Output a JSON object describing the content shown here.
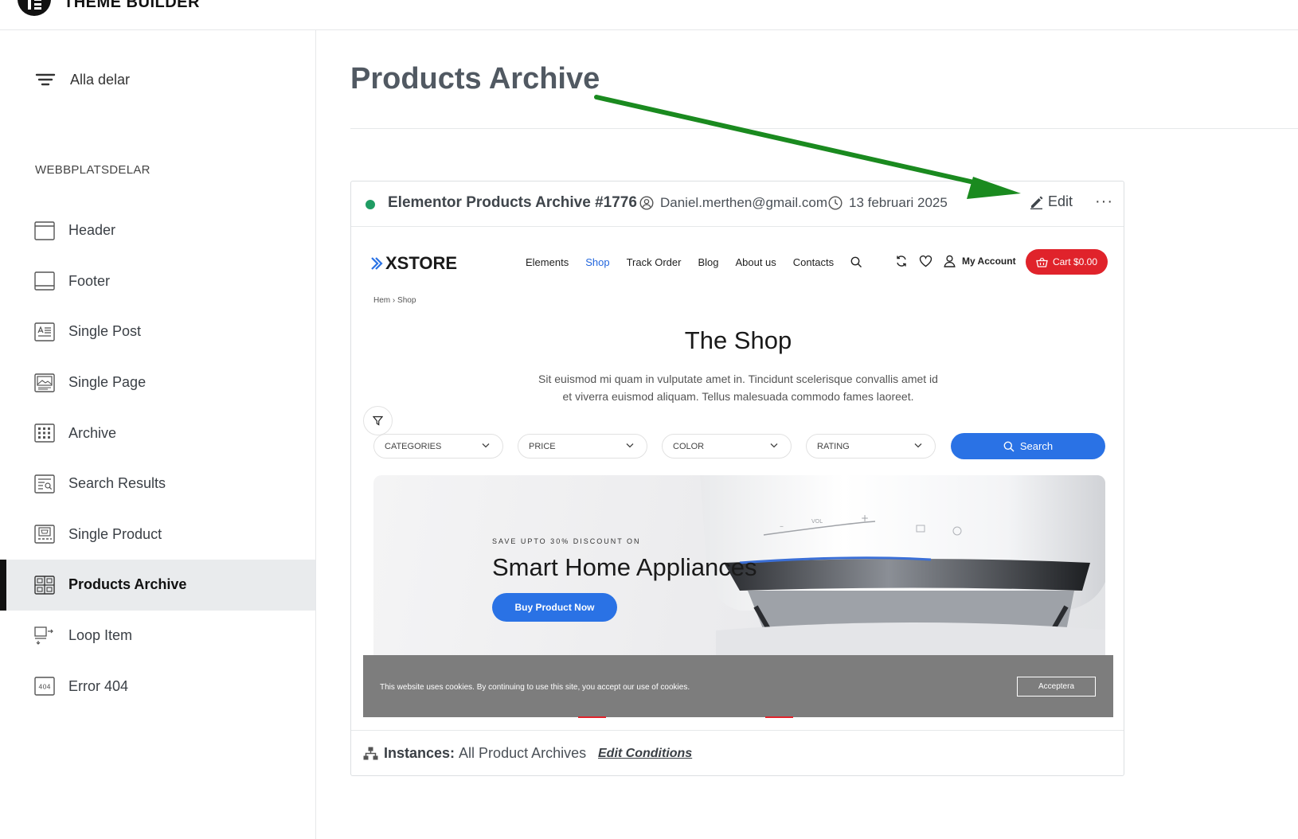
{
  "app": {
    "title": "THEME BUILDER"
  },
  "sidebar": {
    "all_parts": "Alla delar",
    "section_label": "WEBBPLATSDELAR",
    "items": [
      {
        "label": "Header",
        "icon": "header-icon"
      },
      {
        "label": "Footer",
        "icon": "footer-icon"
      },
      {
        "label": "Single Post",
        "icon": "single-post-icon"
      },
      {
        "label": "Single Page",
        "icon": "single-page-icon"
      },
      {
        "label": "Archive",
        "icon": "archive-icon"
      },
      {
        "label": "Search Results",
        "icon": "search-results-icon"
      },
      {
        "label": "Single Product",
        "icon": "single-product-icon"
      },
      {
        "label": "Products Archive",
        "icon": "products-archive-icon",
        "active": true
      },
      {
        "label": "Loop Item",
        "icon": "loop-item-icon"
      },
      {
        "label": "Error 404",
        "icon": "error-404-icon"
      }
    ]
  },
  "main": {
    "title": "Products Archive"
  },
  "card": {
    "name": "Elementor Products Archive #1776",
    "author": "Daniel.merthen@gmail.com",
    "date": "13 februari 2025",
    "edit_label": "Edit",
    "more_label": "···",
    "status_color": "#1f9c63",
    "instances_label": "Instances:",
    "instances_value": "All Product Archives",
    "edit_conditions": "Edit Conditions"
  },
  "preview": {
    "logo_text": "XSTORE",
    "nav": [
      "Elements",
      "Shop",
      "Track Order",
      "Blog",
      "About us",
      "Contacts"
    ],
    "nav_current": "Shop",
    "account": "My Account",
    "cart": "Cart $0.00",
    "breadcrumb": [
      "Hem",
      "Shop"
    ],
    "breadcrumb_sep": "›",
    "shop_title": "The Shop",
    "shop_desc_line1": "Sit euismod mi quam in vulputate amet in. Tincidunt scelerisque convallis amet id",
    "shop_desc_line2": "et viverra euismod aliquam. Tellus malesuada commodo fames laoreet.",
    "filters": [
      "CATEGORIES",
      "PRICE",
      "COLOR",
      "RATING"
    ],
    "search_label": "Search",
    "banner": {
      "small": "SAVE UPTO 30% DISCOUNT ON",
      "title": "Smart Home Appliances",
      "button": "Buy Product Now",
      "appliance_labels": [
        "VOL",
        "–",
        "+"
      ]
    },
    "cookie_text": "This website uses cookies. By continuing to use this site, you accept our use of cookies.",
    "cookie_accept": "Acceptera"
  },
  "colors": {
    "accent_blue": "#2a72e5",
    "cart_red": "#e0232b",
    "arrow_green": "#1a8a1f"
  }
}
